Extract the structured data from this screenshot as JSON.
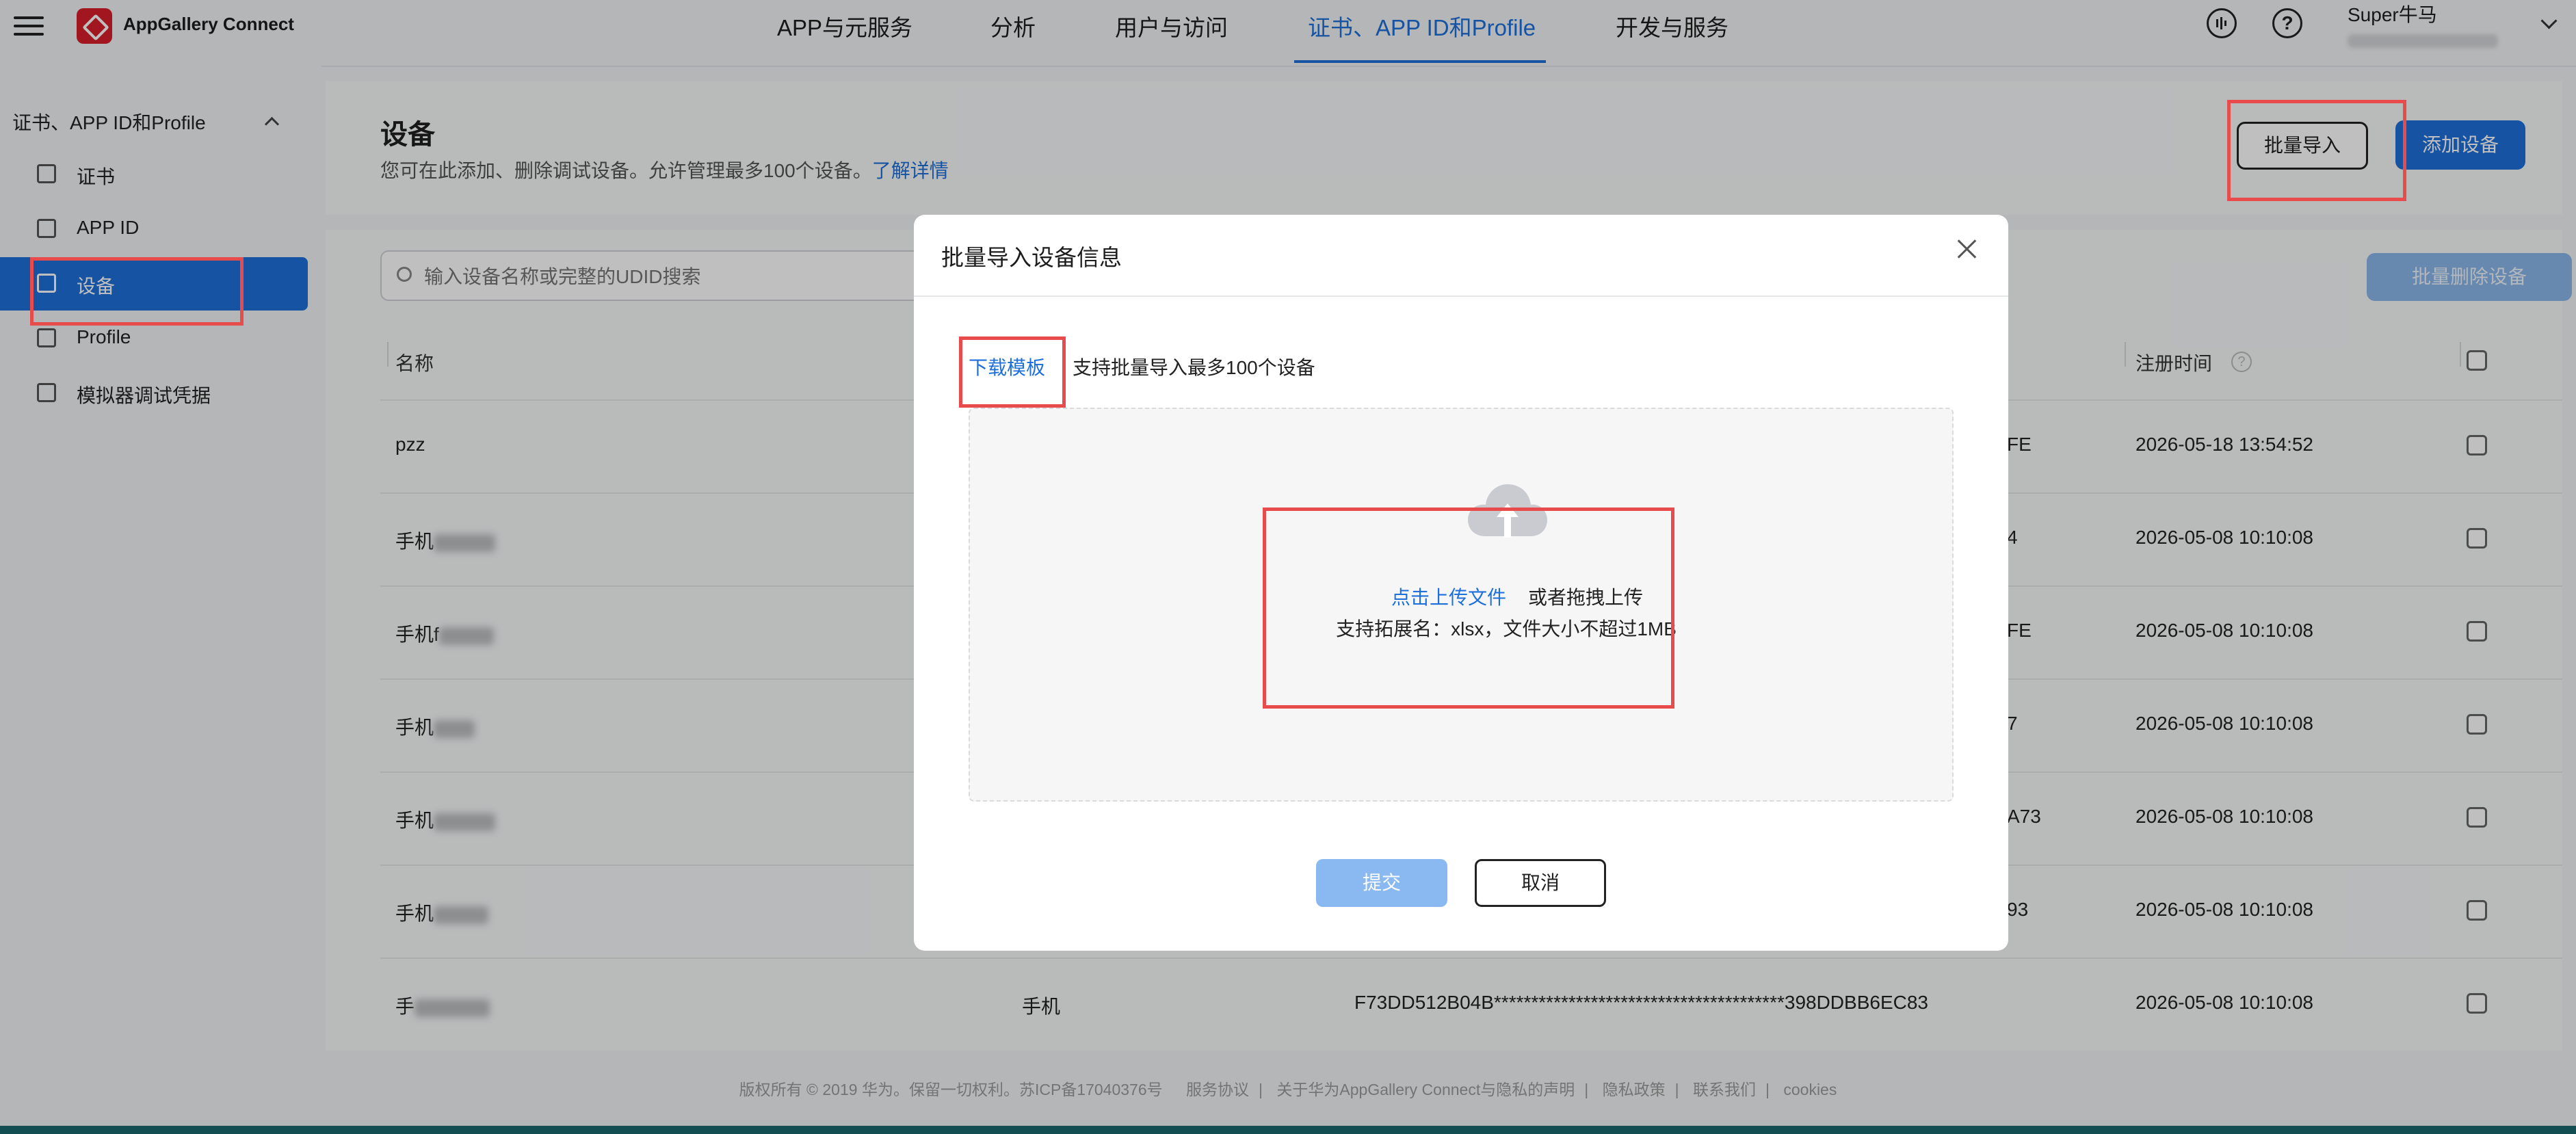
{
  "topbar": {
    "logo": "AppGallery Connect",
    "nav": [
      "APP与元服务",
      "分析",
      "用户与访问",
      "证书、APP ID和Profile",
      "开发与服务"
    ],
    "active_nav": "证书、APP ID和Profile",
    "help_glyph": "?",
    "user_name": "Super牛马",
    "icons": [
      "menu-icon",
      "feedback-icon",
      "help-icon",
      "chevron-down-icon"
    ]
  },
  "sidebar": {
    "group": "证书、APP ID和Profile",
    "items": [
      {
        "label": "证书"
      },
      {
        "label": "APP ID"
      },
      {
        "label": "设备"
      },
      {
        "label": "Profile"
      },
      {
        "label": "模拟器调试凭据"
      }
    ],
    "active": "设备"
  },
  "page": {
    "title": "设备",
    "description": "您可在此添加、删除调试设备。允许管理最多100个设备。",
    "learn_more": "了解详情",
    "batch_import": "批量导入",
    "add_device": "添加设备",
    "search_placeholder": "输入设备名称或完整的UDID搜索",
    "batch_delete": "批量删除设备"
  },
  "table": {
    "col_name": "名称",
    "col_time": "注册时间",
    "rows": [
      {
        "name": "pzz",
        "type": "",
        "udid_tail": "FE",
        "time": "2026-05-18 13:54:52"
      },
      {
        "name": "手机",
        "type": "",
        "udid_tail": "4",
        "time": "2026-05-08 10:10:08"
      },
      {
        "name": "手机f",
        "type": "",
        "udid_tail": "FE",
        "time": "2026-05-08 10:10:08"
      },
      {
        "name": "手机",
        "type": "",
        "udid_tail": "7",
        "time": "2026-05-08 10:10:08"
      },
      {
        "name": "手机",
        "type": "",
        "udid_tail": "A73",
        "time": "2026-05-08 10:10:08"
      },
      {
        "name": "手机",
        "type": "",
        "udid_tail": "93",
        "time": "2026-05-08 10:10:08"
      },
      {
        "name": "手",
        "type": "手机",
        "udid": "F73DD512B04B***************************************398DDBB6EC83",
        "time": "2026-05-08 10:10:08"
      }
    ]
  },
  "modal": {
    "title": "批量导入设备信息",
    "download_template": "下载模板",
    "download_hint": "支持批量导入最多100个设备",
    "upload_link": "点击上传文件",
    "upload_drag": "或者拖拽上传",
    "upload_hint": "支持拓展名：xlsx，文件大小不超过1MB",
    "submit": "提交",
    "cancel": "取消"
  },
  "footer": {
    "copyright": "版权所有 © 2019 华为。保留一切权利。苏ICP备17040376号",
    "links": [
      "服务协议",
      "关于华为AppGallery Connect与隐私的声明",
      "隐私政策",
      "联系我们",
      "cookies"
    ]
  },
  "colors": {
    "accent": "#1e6fd9",
    "highlight": "#e84b4b"
  }
}
